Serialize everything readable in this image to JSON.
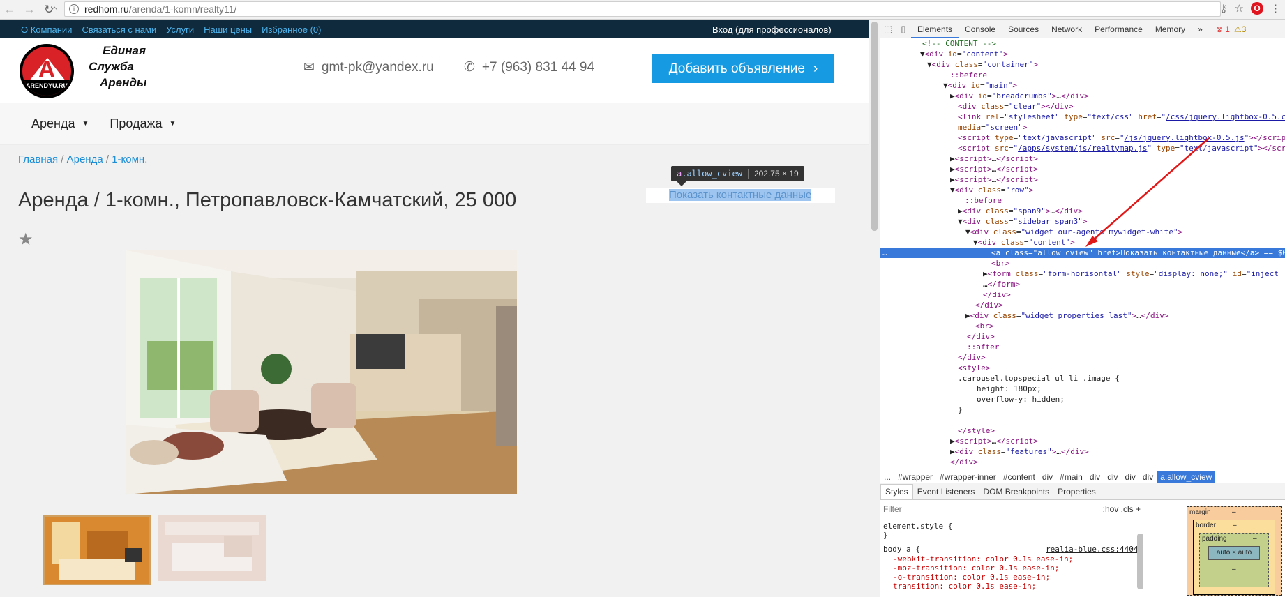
{
  "browser": {
    "url_host": "redhom.ru",
    "url_path": "/arenda/1-komn/realty11/"
  },
  "site": {
    "topnav": [
      "О Компании",
      "Связаться с нами",
      "Услуги",
      "Наши цены",
      "Избранное (0)"
    ],
    "login": "Вход (для профессионалов)",
    "logo_letter": "А",
    "logo_text": "ARENDYU.RU",
    "tagline": [
      "Единая",
      "Служба",
      "Аренды"
    ],
    "email": "gmt-pk@yandex.ru",
    "phone": "+7 (963) 831 44 94",
    "add_button": "Добавить объявление",
    "menu": [
      "Аренда",
      "Продажа"
    ],
    "breadcrumbs": [
      "Главная",
      "Аренда",
      "1-комн."
    ],
    "title": "Аренда / 1-комн., Петропавловск-Камчатский, 25 000",
    "contact_link": "Показать контактные данные",
    "tooltip_tag": "a",
    "tooltip_class": ".allow_cview",
    "tooltip_dims": "202.75 × 19"
  },
  "devtools": {
    "tabs": [
      "Elements",
      "Console",
      "Sources",
      "Network",
      "Performance",
      "Memory"
    ],
    "more": "»",
    "errors": "1",
    "warnings": "3",
    "breadcrumbs": [
      "...",
      "#wrapper",
      "#wrapper-inner",
      "#content",
      "div",
      "#main",
      "div",
      "div",
      "div",
      "div",
      "a.allow_cview"
    ],
    "subtabs": [
      "Styles",
      "Event Listeners",
      "DOM Breakpoints",
      "Properties"
    ],
    "filter": "Filter",
    "filter_opts": ":hov  .cls  +",
    "styles": {
      "element_style": "element.style {",
      "close": "}",
      "rule": "body a {",
      "source": "realia-blue.css:4404",
      "lines": [
        "-webkit-transition: color 0.1s ease-in;",
        "-moz-transition: color 0.1s ease-in;",
        "-o-transition: color 0.1s ease-in;",
        "transition: color 0.1s ease-in;"
      ]
    },
    "boxmodel": {
      "margin": "margin",
      "border": "border",
      "padding": "padding",
      "content": "auto × auto",
      "dash": "–"
    }
  }
}
